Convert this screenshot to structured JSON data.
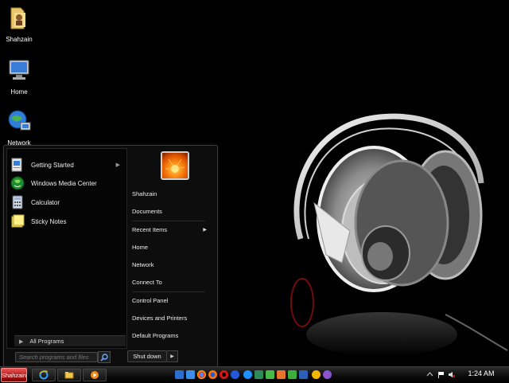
{
  "desktop": {
    "icons": [
      {
        "label": "Shahzain",
        "icon": "folder-icon"
      },
      {
        "label": "Home",
        "icon": "computer-icon"
      },
      {
        "label": "Network",
        "icon": "network-globe-icon"
      }
    ]
  },
  "start_menu": {
    "programs": [
      {
        "label": "Getting Started",
        "icon": "getting-started-icon",
        "has_submenu": true
      },
      {
        "label": "Windows Media Center",
        "icon": "media-center-icon",
        "has_submenu": false
      },
      {
        "label": "Calculator",
        "icon": "calculator-icon",
        "has_submenu": false
      },
      {
        "label": "Sticky Notes",
        "icon": "sticky-notes-icon",
        "has_submenu": false
      }
    ],
    "all_programs_label": "All Programs",
    "search_placeholder": "Search programs and files",
    "user_picture": "flower-user-picture",
    "right_items": [
      {
        "label": "Shahzain"
      },
      {
        "label": "Documents"
      },
      {
        "label": "Recent Items",
        "has_submenu": true
      },
      {
        "label": "Home"
      },
      {
        "label": "Network"
      },
      {
        "label": "Connect To"
      },
      {
        "label": "Control Panel"
      },
      {
        "label": "Devices and Printers"
      },
      {
        "label": "Default Programs"
      }
    ],
    "shutdown_label": "Shut down"
  },
  "taskbar": {
    "start_label": "Shahzain",
    "pinned": [
      "internet-explorer-icon",
      "windows-explorer-icon",
      "media-player-icon"
    ],
    "quick_launch_icons": [
      "show-desktop-icon",
      "window-switcher-icon",
      "chrome-icon",
      "firefox-icon",
      "opera-icon",
      "media-icon",
      "ie-icon",
      "network-icon",
      "messenger-icon",
      "photoshop-icon",
      "flash-icon",
      "word-icon",
      "app-icon",
      "app-icon-2"
    ],
    "tray": {
      "clock": "1:24 AM"
    }
  },
  "colors": {
    "accent_start": "#c22222",
    "menu_bg": "#0d0d0d",
    "desktop_bg": "#000000"
  }
}
